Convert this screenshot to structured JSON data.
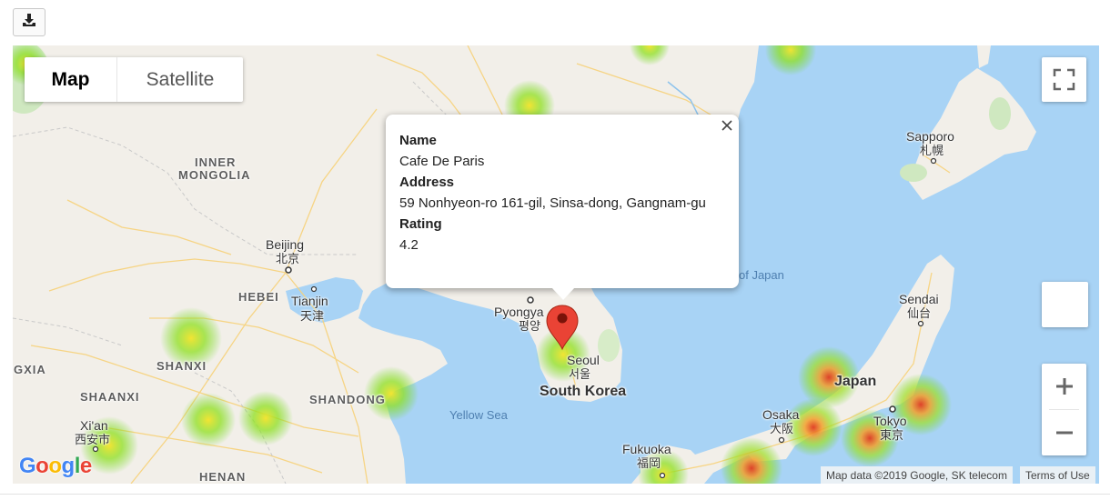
{
  "toolbar": {
    "download_icon": "download-icon"
  },
  "map_type": {
    "map_label": "Map",
    "satellite_label": "Satellite",
    "selected": "Map"
  },
  "info_window": {
    "name_label": "Name",
    "name_value": "Cafe De Paris",
    "address_label": "Address",
    "address_value": "59 Nonhyeon-ro 161-gil, Sinsa-dong, Gangnam-gu",
    "rating_label": "Rating",
    "rating_value": "4.2",
    "close_icon": "close-icon"
  },
  "labels": {
    "inner_mongolia_1": "INNER",
    "inner_mongolia_2": "MONGOLIA",
    "beijing": "Beijing",
    "beijing_cjk": "北京",
    "tianjin": "Tianjin",
    "tianjin_cjk": "天津",
    "hebei": "HEBEI",
    "shanxi": "SHANXI",
    "shaanxi": "SHAANXI",
    "gxia": "GXIA",
    "shandong": "SHANDONG",
    "xian": "Xi'an",
    "xian_cjk": "西安市",
    "henan": "HENAN",
    "yellow_sea": "Yellow Sea",
    "sea_of_japan": "of Japan",
    "pyongyang": "Pyongya",
    "pyongyang_cjk": "평양",
    "seoul": "Seoul",
    "seoul_cjk": "서울",
    "south_korea": "South Korea",
    "fukuoka": "Fukuoka",
    "fukuoka_cjk": "福岡",
    "osaka": "Osaka",
    "osaka_cjk": "大阪",
    "japan": "Japan",
    "tokyo": "Tokyo",
    "tokyo_cjk": "東京",
    "sendai": "Sendai",
    "sendai_cjk": "仙台",
    "sapporo": "Sapporo",
    "sapporo_cjk": "札幌"
  },
  "google_logo": "Google",
  "attribution": {
    "map_data": "Map data ©2019 Google, SK telecom",
    "terms": "Terms of Use"
  },
  "colors": {
    "water": "#a8d3f5",
    "land": "#f2efe9",
    "heat_low": "#7ddc1f",
    "heat_high": "#e03a1f",
    "marker": "#ea4335"
  }
}
